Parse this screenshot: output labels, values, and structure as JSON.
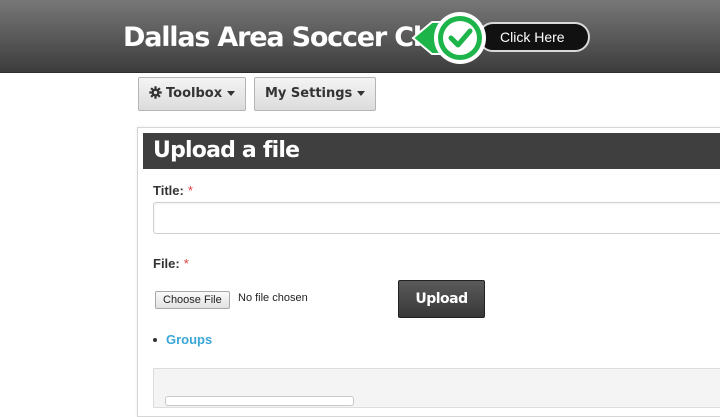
{
  "header": {
    "site_title": "Dallas Area Soccer Club",
    "claim_button_label": "Click Here",
    "check_icon": "check-icon",
    "colors": {
      "header_bg": "#5d5d5d",
      "check_green": "#1db54a"
    }
  },
  "toolbar": {
    "toolbox_label": "Toolbox",
    "toolbox_icon": "gear-icon",
    "settings_label": "My Settings"
  },
  "form": {
    "heading": "Upload a file",
    "title_label": "Title:",
    "title_value": "",
    "file_label": "File:",
    "required_marker": "*",
    "choose_file_label": "Choose File",
    "no_file_text": "No file chosen",
    "upload_label": "Upload",
    "groups_link": "Groups",
    "colors": {
      "link": "#3aa6d8",
      "required": "#e03a3a",
      "title_bar": "#3f3f3f"
    }
  }
}
